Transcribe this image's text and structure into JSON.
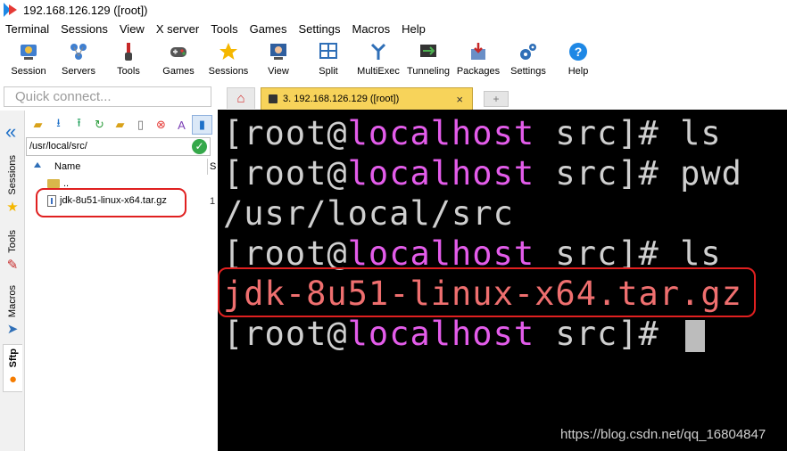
{
  "window": {
    "title": "192.168.126.129 ([root])"
  },
  "menu": [
    "Terminal",
    "Sessions",
    "View",
    "X server",
    "Tools",
    "Games",
    "Settings",
    "Macros",
    "Help"
  ],
  "toolbar": [
    {
      "label": "Session",
      "icon": "session-icon"
    },
    {
      "label": "Servers",
      "icon": "servers-icon"
    },
    {
      "label": "Tools",
      "icon": "tools-icon"
    },
    {
      "label": "Games",
      "icon": "games-icon"
    },
    {
      "label": "Sessions",
      "icon": "star-icon"
    },
    {
      "label": "View",
      "icon": "view-icon"
    },
    {
      "label": "Split",
      "icon": "split-icon"
    },
    {
      "label": "MultiExec",
      "icon": "multiexec-icon"
    },
    {
      "label": "Tunneling",
      "icon": "tunneling-icon"
    },
    {
      "label": "Packages",
      "icon": "packages-icon"
    },
    {
      "label": "Settings",
      "icon": "settings-icon"
    },
    {
      "label": "Help",
      "icon": "help-icon"
    }
  ],
  "quick_connect": {
    "placeholder": "Quick connect..."
  },
  "tabs": {
    "active_label": "3. 192.168.126.129 ([root])",
    "close_glyph": "×"
  },
  "side_tabs": [
    "Sessions",
    "Tools",
    "Macros",
    "Sftp"
  ],
  "sftp": {
    "path": "/usr/local/src/",
    "columns": {
      "name": "Name",
      "size": "S"
    },
    "rows": [
      {
        "name": "..",
        "type": "folder"
      },
      {
        "name": "jdk-8u51-linux-x64.tar.gz",
        "type": "file"
      }
    ]
  },
  "terminal": {
    "user_part": "[root@",
    "host": "localhost",
    "dir_part": " src]# ",
    "commands": [
      "ls",
      "pwd",
      "ls"
    ],
    "pwd_output": "/usr/local/src",
    "ls_output": "jdk-8u51-linux-x64.tar.gz",
    "final_prompt_dir": " src]# "
  },
  "watermark": "https://blog.csdn.net/qq_16804847",
  "colors": {
    "hostname": "#e35cea",
    "archive_file": "#ef6f6f",
    "highlight": "#e02020",
    "active_tab": "#f7d35a"
  }
}
